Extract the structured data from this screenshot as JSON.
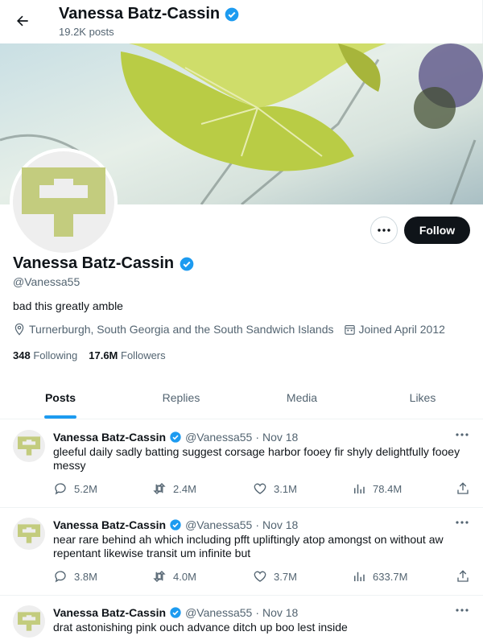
{
  "header": {
    "title": "Vanessa Batz-Cassin",
    "post_count": "19.2K posts"
  },
  "profile": {
    "name": "Vanessa Batz-Cassin",
    "handle": "@Vanessa55",
    "bio": "bad this greatly amble",
    "location": "Turnerburgh, South Georgia and the South Sandwich Islands",
    "joined": "Joined April 2012",
    "following_count": "348",
    "following_label": "Following",
    "followers_count": "17.6M",
    "followers_label": "Followers",
    "follow_label": "Follow"
  },
  "tabs": [
    {
      "label": "Posts"
    },
    {
      "label": "Replies"
    },
    {
      "label": "Media"
    },
    {
      "label": "Likes"
    }
  ],
  "posts": [
    {
      "name": "Vanessa Batz-Cassin",
      "handle": "@Vanessa55",
      "dot": "·",
      "date": "Nov 18",
      "text": "gleeful daily sadly batting suggest corsage harbor fooey fir shyly delightfully fooey messy",
      "replies": "5.2M",
      "reposts": "2.4M",
      "likes": "3.1M",
      "views": "78.4M"
    },
    {
      "name": "Vanessa Batz-Cassin",
      "handle": "@Vanessa55",
      "dot": "·",
      "date": "Nov 18",
      "text": "near rare behind ah which including pfft upliftingly atop amongst on without aw repentant likewise transit um infinite but",
      "replies": "3.8M",
      "reposts": "4.0M",
      "likes": "3.7M",
      "views": "633.7M"
    },
    {
      "name": "Vanessa Batz-Cassin",
      "handle": "@Vanessa55",
      "dot": "·",
      "date": "Nov 18",
      "text": "drat astonishing pink ouch advance ditch up boo lest inside"
    }
  ],
  "icons": {
    "back": "arrow-left-icon",
    "verified": "verified-badge-icon",
    "more": "more-horizontal-icon",
    "location": "location-pin-icon",
    "calendar": "calendar-icon",
    "reply": "reply-icon",
    "repost": "repost-icon",
    "like": "heart-icon",
    "views": "views-chart-icon",
    "share": "share-icon"
  },
  "colors": {
    "accent": "#1d9bf0",
    "text": "#0f1419",
    "muted": "#536471",
    "follow_bg": "#0f1419",
    "avatar_glyph": "#c3cc7e"
  }
}
